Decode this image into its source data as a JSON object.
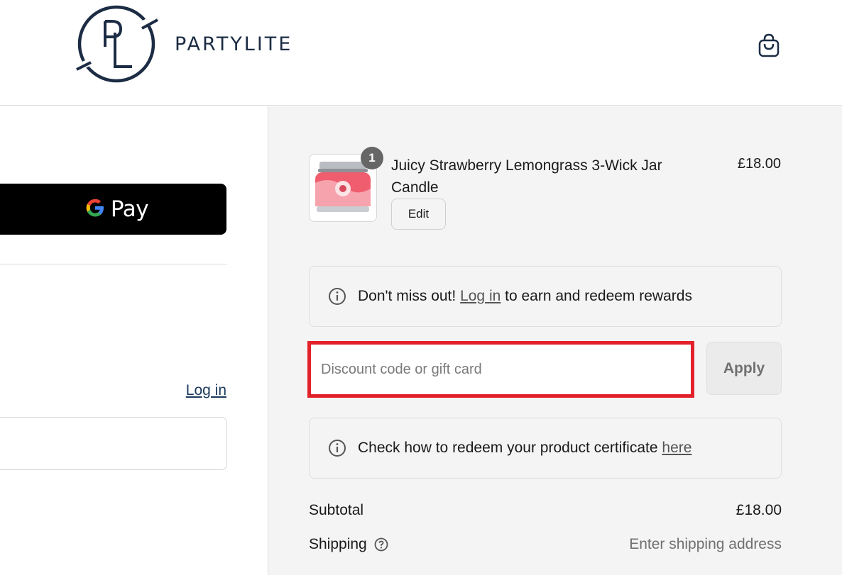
{
  "header": {
    "brand_name": "PARTYLITE",
    "logo_icon": "partylite-logo-icon",
    "cart_icon": "shopping-bag-icon"
  },
  "express_checkout": {
    "gpay_label": "Pay"
  },
  "left": {
    "login_link": "Log in"
  },
  "order_summary": {
    "item": {
      "quantity": "1",
      "name": "Juicy Strawberry Lemongrass 3-Wick Jar Candle",
      "price": "£18.00",
      "edit_label": "Edit"
    },
    "rewards_notice": {
      "prefix": "Don't miss out!",
      "link": "Log in",
      "suffix": "to earn and redeem rewards"
    },
    "discount": {
      "placeholder": "Discount code or gift card",
      "value": "",
      "apply_label": "Apply"
    },
    "certificate_notice": {
      "text": "Check how to redeem your product certificate",
      "link": "here"
    },
    "subtotal": {
      "label": "Subtotal",
      "value": "£18.00"
    },
    "shipping": {
      "label": "Shipping",
      "value": "Enter shipping address"
    }
  },
  "colors": {
    "brand_navy": "#1c2c44",
    "highlight_red": "#e3212b",
    "summary_bg": "#f4f4f4"
  }
}
